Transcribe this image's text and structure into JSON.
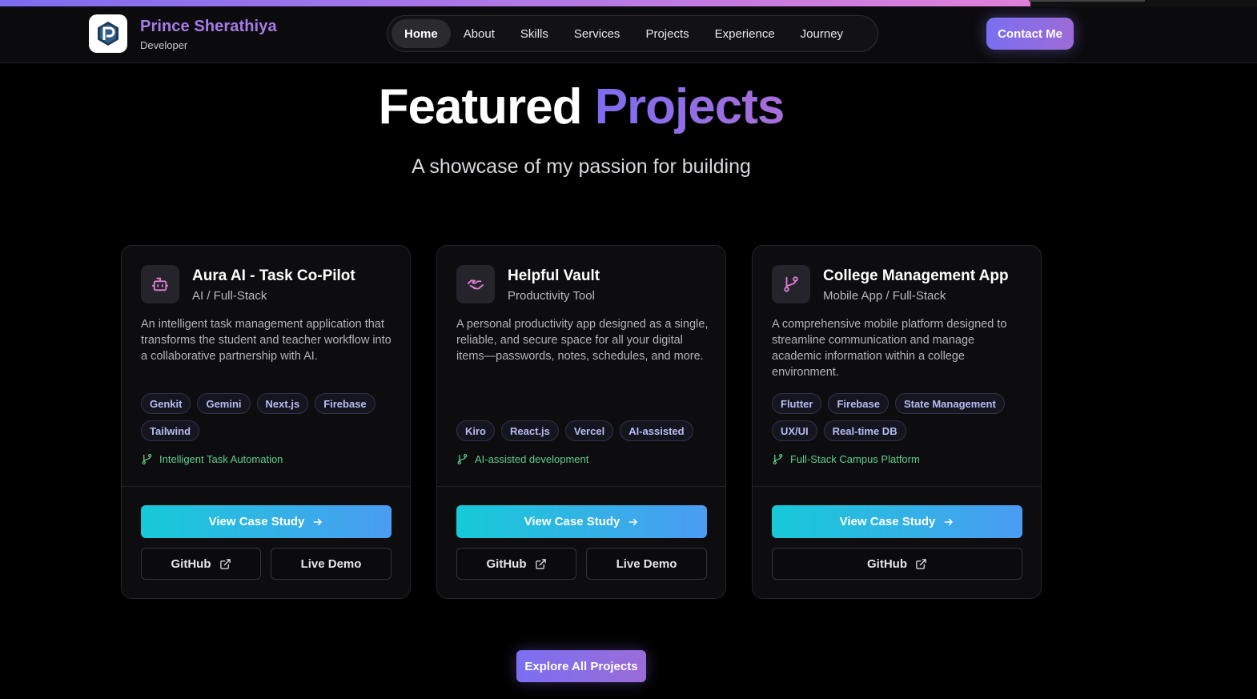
{
  "page": {
    "scroll_progress_percent": 82
  },
  "header": {
    "brand_name": "Prince Sherathiya",
    "brand_role": "Developer",
    "logo_icon": "p-monogram-logo",
    "nav": [
      {
        "label": "Home",
        "active": true
      },
      {
        "label": "About",
        "active": false
      },
      {
        "label": "Skills",
        "active": false
      },
      {
        "label": "Services",
        "active": false
      },
      {
        "label": "Projects",
        "active": false
      },
      {
        "label": "Experience",
        "active": false
      },
      {
        "label": "Journey",
        "active": false
      }
    ],
    "contact_label": "Contact Me"
  },
  "section": {
    "title_plain": "Featured",
    "title_accent": "Projects",
    "subtitle": "A showcase of my passion for building"
  },
  "projects": [
    {
      "icon": "robot-icon",
      "title": "Aura AI - Task Co-Pilot",
      "category": "AI / Full-Stack",
      "description": "An intelligent task management application that transforms the student and teacher workflow into a collaborative partnership with AI.",
      "tags": [
        "Genkit",
        "Gemini",
        "Next.js",
        "Firebase",
        "Tailwind"
      ],
      "highlight": "Intelligent Task Automation",
      "case_study_label": "View Case Study",
      "github_label": "GitHub",
      "demo_label": "Live Demo"
    },
    {
      "icon": "handshake-icon",
      "title": "Helpful Vault",
      "category": "Productivity Tool",
      "description": "A personal productivity app designed as a single, reliable, and secure space for all your digital items—passwords, notes, schedules, and more.",
      "tags": [
        "Kiro",
        "React.js",
        "Vercel",
        "AI-assisted"
      ],
      "highlight": "AI-assisted development",
      "case_study_label": "View Case Study",
      "github_label": "GitHub",
      "demo_label": "Live Demo"
    },
    {
      "icon": "git-branch-icon",
      "title": "College Management App",
      "category": "Mobile App / Full-Stack",
      "description": "A comprehensive mobile platform designed to streamline communication and manage academic information within a college environment.",
      "tags": [
        "Flutter",
        "Firebase",
        "State Management",
        "UX/UI",
        "Real-time DB"
      ],
      "highlight": "Full-Stack Campus Platform",
      "case_study_label": "View Case Study",
      "github_label": "GitHub"
    }
  ],
  "explore_label": "Explore All Projects",
  "colors": {
    "accent_purple": "#7b6ff0",
    "cyan_gradient_start": "#16cad8",
    "cyan_gradient_end": "#4b9cf2",
    "highlight_green": "#5fd08d",
    "tag_text": "#b6bdf3",
    "icon_pink": "#e07fd8"
  }
}
